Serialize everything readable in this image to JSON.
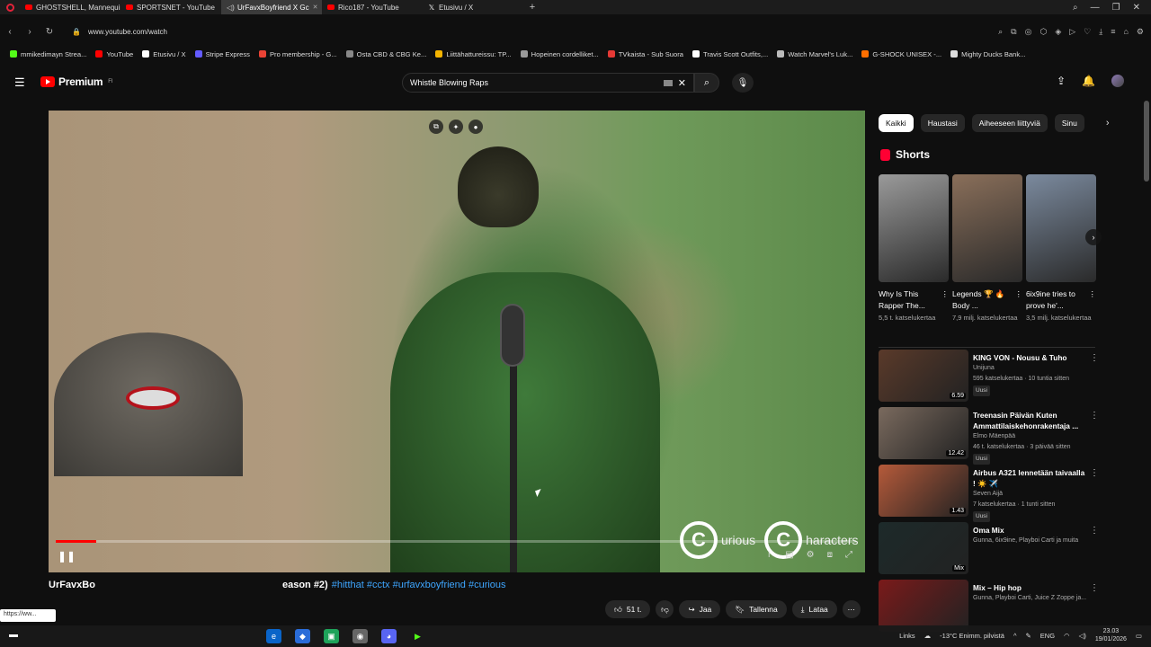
{
  "browser": {
    "tabs": [
      {
        "label": "GHOSTSHELL, Mannequin",
        "favicon": "youtube-icon"
      },
      {
        "label": "SPORTSNET - YouTube",
        "favicon": "youtube-icon"
      },
      {
        "label": "UrFavxBoyfriend X Gc",
        "favicon": "speaker-icon",
        "active": true
      },
      {
        "label": "Rico187 - YouTube",
        "favicon": "youtube-icon"
      },
      {
        "label": "Etusivu / X",
        "favicon": "x-icon"
      }
    ],
    "url": "www.youtube.com/watch",
    "bookmarks": [
      {
        "label": "mmikedimayn Strea...",
        "color": "#53fc18"
      },
      {
        "label": "YouTube",
        "color": "#ff0000"
      },
      {
        "label": "Etusivu / X",
        "color": "#ffffff"
      },
      {
        "label": "Stripe Express",
        "color": "#635bff"
      },
      {
        "label": "Pro membership - G...",
        "color": "#ea4335"
      },
      {
        "label": "Osta CBD & CBG Ke...",
        "color": "#888888"
      },
      {
        "label": "Liittähattureissu: TP...",
        "color": "#f4b400"
      },
      {
        "label": "Hopeinen cordelliket...",
        "color": "#999999"
      },
      {
        "label": "TVkaista - Sub Suora",
        "color": "#e53935"
      },
      {
        "label": "Travis Scott Outfits,...",
        "color": "#ffffff"
      },
      {
        "label": "Watch Marvel's Luk...",
        "color": "#bbbbbb"
      },
      {
        "label": "G-SHOCK UNISEX -...",
        "color": "#ff6f00"
      },
      {
        "label": "Mighty Ducks Bank...",
        "color": "#dddddd"
      }
    ]
  },
  "youtube": {
    "logo_text": "Premium",
    "logo_sup": "FI",
    "search_value": "Whistle Blowing Raps"
  },
  "player": {
    "progress_fraction": 0.05,
    "copyright_words": [
      "urious",
      "haracters"
    ],
    "copyright_symbol": "C"
  },
  "video": {
    "title_start": "UrFavxBo",
    "title_end": "eason #2)",
    "hashtags": "#hitthat #cctx #urfavxboyfriend #curious",
    "likes": "51 t.",
    "share_label": "Jaa",
    "save_label": "Tallenna",
    "download_label": "Lataa"
  },
  "status_url": "https://ww...",
  "sidebar": {
    "chips": [
      "Kaikki",
      "Haustasi",
      "Aiheeseen liittyviä",
      "Sinu"
    ],
    "shorts_label": "Shorts",
    "shorts": [
      {
        "title": "Why Is This Rapper The...",
        "views": "5,5 t. katselukertaa",
        "color": "#9a9a9a"
      },
      {
        "title": "Legends 🏆 🔥Body ...",
        "views": "7,9 milj. katselukertaa",
        "color": "#8a6f5a"
      },
      {
        "title": "6ix9ine tries to prove he'...",
        "views": "3,5 milj. katselukertaa",
        "color": "#7b8a9e"
      }
    ],
    "recommendations": [
      {
        "title": "KING VON - Nousu & Tuho",
        "channel": "Unijuna",
        "meta": "595 katselukertaa · 10 tuntia sitten",
        "badge": "Uusi",
        "duration": "6.59",
        "color": "#5a3a2a"
      },
      {
        "title": "Treenasin Päivän Kuten Ammattilaiskehonrakentaja ...",
        "channel": "Elmo Mäenpää",
        "meta": "46 t. katselukertaa · 3 päivää sitten",
        "badge": "Uusi",
        "duration": "12.42",
        "color": "#7a6a5e"
      },
      {
        "title": "Airbus A321 lennetään taivaalla ! ☀️ ✈️",
        "channel": "Seven Aijä",
        "meta": "7 katselukertaa · 1 tunti sitten",
        "badge": "Uusi",
        "duration": "1.43",
        "color": "#b55a3a"
      },
      {
        "title": "Oma Mix",
        "channel": "Gunna, 6ix9ine, Playboi Carti ja muita",
        "meta": "",
        "badge": "",
        "duration": "Mix",
        "color": "#1d2a2a"
      },
      {
        "title": "Mix – Hip hop",
        "channel": "Gunna, Playboi Carti, Juice Z Zoppe ja...",
        "meta": "",
        "badge": "",
        "duration": "",
        "color": "#7a1a1a"
      }
    ]
  },
  "taskbar": {
    "links_label": "Links",
    "weather": "-13°C  Enimm. pilvistä",
    "lang": "ENG",
    "time": "23.03",
    "date": "19/01/2026"
  }
}
